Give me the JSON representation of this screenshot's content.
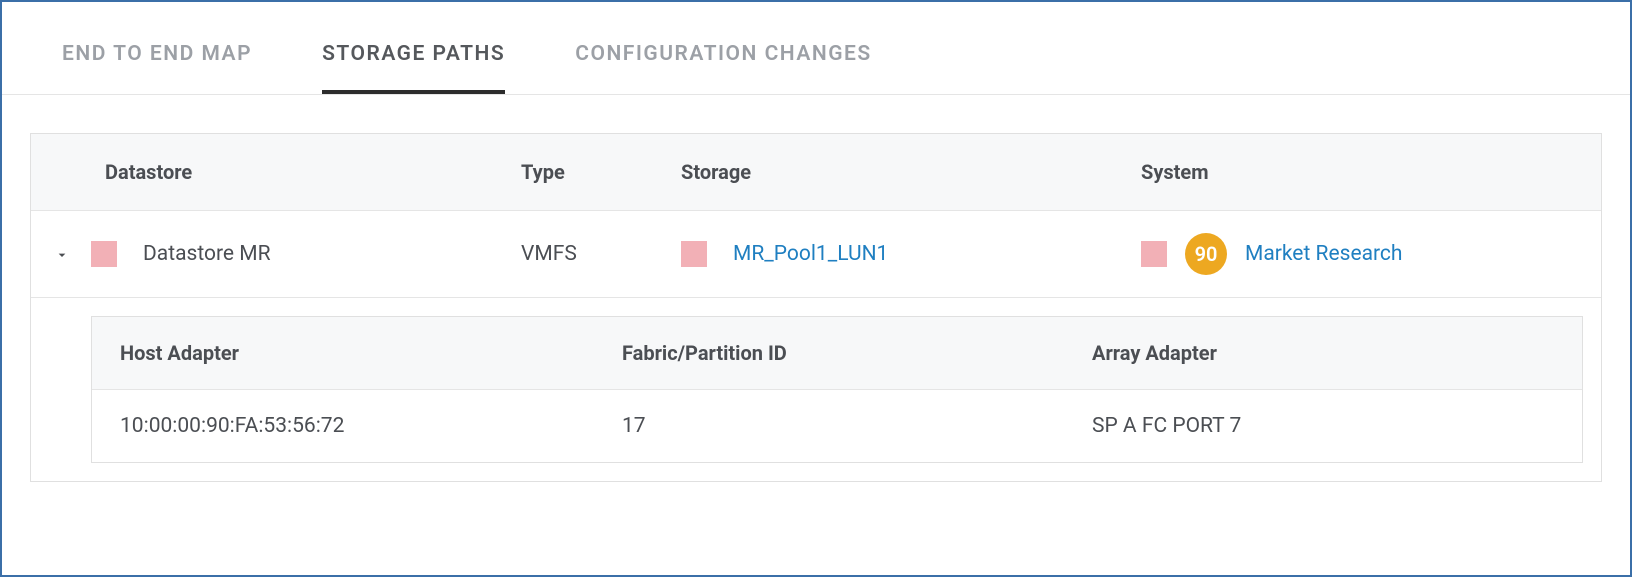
{
  "tabs": {
    "end_to_end": "END TO END MAP",
    "storage_paths": "STORAGE PATHS",
    "config_changes": "CONFIGURATION CHANGES"
  },
  "main_table": {
    "headers": {
      "datastore": "Datastore",
      "type": "Type",
      "storage": "Storage",
      "system": "System"
    },
    "row": {
      "datastore_name": "Datastore MR",
      "type": "VMFS",
      "storage_link": "MR_Pool1_LUN1",
      "system_score": "90",
      "system_link": "Market Research"
    }
  },
  "sub_table": {
    "headers": {
      "host_adapter": "Host Adapter",
      "fabric_partition": "Fabric/Partition ID",
      "array_adapter": "Array Adapter"
    },
    "row": {
      "host_adapter": "10:00:00:90:FA:53:56:72",
      "fabric_partition": "17",
      "array_adapter": "SP A FC PORT 7"
    }
  }
}
